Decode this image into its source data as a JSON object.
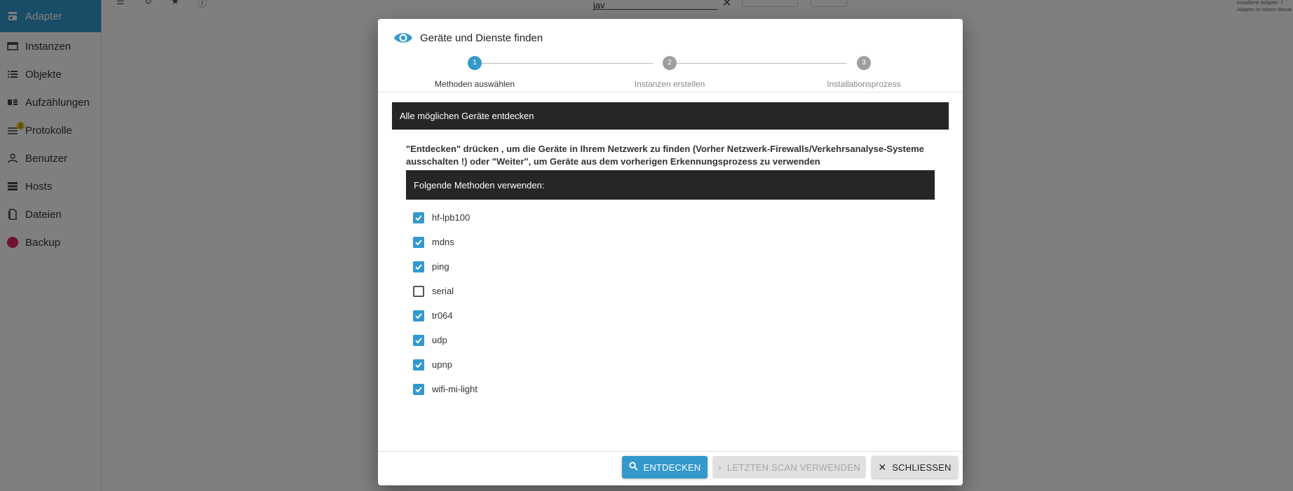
{
  "sidebar": {
    "items": [
      {
        "label": "Adapter",
        "icon": "store-icon",
        "active": true
      },
      {
        "label": "Instanzen",
        "icon": "instances-icon",
        "active": false
      },
      {
        "label": "Objekte",
        "icon": "list-icon",
        "active": false
      },
      {
        "label": "Aufzählungen",
        "icon": "enum-icon",
        "active": false
      },
      {
        "label": "Protokolle",
        "icon": "log-icon",
        "active": false,
        "badge": "2"
      },
      {
        "label": "Benutzer",
        "icon": "user-icon",
        "active": false
      },
      {
        "label": "Hosts",
        "icon": "hosts-icon",
        "active": false
      },
      {
        "label": "Dateien",
        "icon": "file-icon",
        "active": false
      },
      {
        "label": "Backup",
        "icon": "backup-icon",
        "active": false
      }
    ]
  },
  "topbar": {
    "search_value": "jav",
    "right_note_1": "Installierte Adapter: 7",
    "right_note_2": "Adapter im letzten Monat"
  },
  "dialog": {
    "title": "Geräte und Dienste finden",
    "steps": [
      {
        "number": "1",
        "label": "Methoden auswählen",
        "active": true
      },
      {
        "number": "2",
        "label": "Instanzen erstellen",
        "active": false
      },
      {
        "number": "3",
        "label": "Installationsprozess",
        "active": false
      }
    ],
    "section_title": "Alle möglichen Geräte entdecken",
    "info_text": "\"Entdecken\" drücken , um die Geräte in Ihrem Netzwerk zu finden (Vorher Netzwerk-Firewalls/Verkehrsanalyse-Systeme ausschalten !) oder \"Weiter\", um Geräte aus dem vorherigen Erkennungsprozess zu verwenden",
    "methods_title": "Folgende Methoden verwenden:",
    "methods": [
      {
        "label": "hf-lpb100",
        "checked": true
      },
      {
        "label": "mdns",
        "checked": true
      },
      {
        "label": "ping",
        "checked": true
      },
      {
        "label": "serial",
        "checked": false
      },
      {
        "label": "tr064",
        "checked": true
      },
      {
        "label": "udp",
        "checked": true
      },
      {
        "label": "upnp",
        "checked": true
      },
      {
        "label": "wifi-mi-light",
        "checked": true
      }
    ],
    "buttons": {
      "discover": "ENTDECKEN",
      "use_last_scan": "LETZTEN SCAN VERWENDEN",
      "close": "SCHLIESSEN"
    }
  },
  "colors": {
    "accent": "#3399cc",
    "bar": "#262626"
  }
}
